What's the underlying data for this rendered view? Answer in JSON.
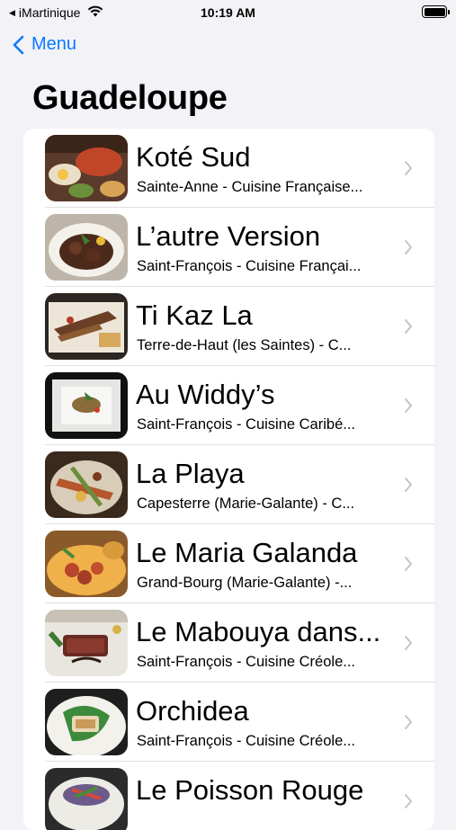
{
  "status_bar": {
    "carrier": "iMartinique",
    "time": "10:19 AM"
  },
  "nav": {
    "back_label": "Menu"
  },
  "page": {
    "title": "Guadeloupe"
  },
  "colors": {
    "accent": "#0a7aff",
    "background": "#f2f2f7",
    "separator": "#e0e0e5",
    "chevron": "#c4c4c7"
  },
  "restaurants": [
    {
      "name": "Koté Sud",
      "subtitle": "Sainte-Anne - Cuisine Française..."
    },
    {
      "name": "L’autre Version",
      "subtitle": "Saint-François - Cuisine Françai..."
    },
    {
      "name": "Ti Kaz La",
      "subtitle": "Terre-de-Haut (les Saintes) - C..."
    },
    {
      "name": "Au Widdy’s",
      "subtitle": "Saint-François - Cuisine Caribé..."
    },
    {
      "name": "La Playa",
      "subtitle": "Capesterre (Marie-Galante) - C..."
    },
    {
      "name": "Le Maria Galanda",
      "subtitle": "Grand-Bourg (Marie-Galante) -..."
    },
    {
      "name": "Le Mabouya dans...",
      "subtitle": "Saint-François - Cuisine Créole..."
    },
    {
      "name": "Orchidea",
      "subtitle": "Saint-François - Cuisine Créole..."
    },
    {
      "name": "Le Poisson Rouge",
      "subtitle": ""
    }
  ]
}
